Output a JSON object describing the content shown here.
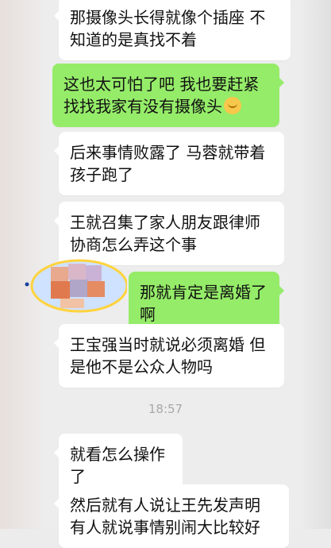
{
  "messages": [
    {
      "side": "left",
      "text": "那摄像头长得就像个插座 不知道的是真找不着"
    },
    {
      "side": "right",
      "text": "这也太可怕了吧 我也要赶紧找找我家有没有摄像头",
      "emoji": "smirk-emoji"
    },
    {
      "side": "left",
      "text": "后来事情败露了 马蓉就带着孩子跑了"
    },
    {
      "side": "left",
      "text": "王就召集了家人朋友跟律师协商怎么弄这个事"
    },
    {
      "side": "right",
      "text": "那就肯定是离婚了啊"
    },
    {
      "side": "left",
      "text": "王宝强当时就说必须离婚 但是他不是公众人物吗"
    },
    {
      "side": "left",
      "text": "就看怎么操作了"
    },
    {
      "side": "left",
      "text": "然后就有人说让王先发声明 有人就说事情别闹大比较好"
    }
  ],
  "timestamp": "18:57",
  "colors": {
    "background": "#ededed",
    "left_bubble": "#ffffff",
    "right_bubble": "#95ec69"
  }
}
